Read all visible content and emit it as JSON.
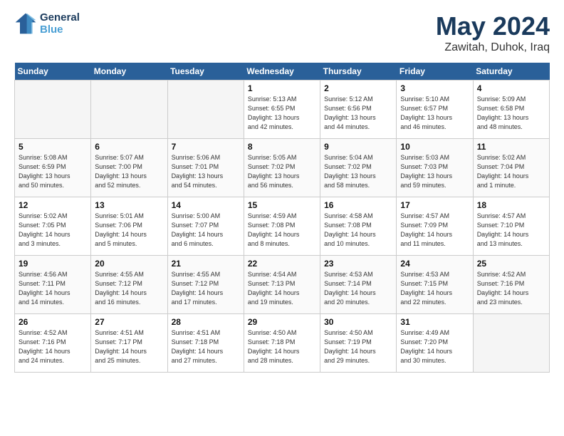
{
  "header": {
    "logo_line1": "General",
    "logo_line2": "Blue",
    "month": "May 2024",
    "location": "Zawitah, Duhok, Iraq"
  },
  "weekdays": [
    "Sunday",
    "Monday",
    "Tuesday",
    "Wednesday",
    "Thursday",
    "Friday",
    "Saturday"
  ],
  "weeks": [
    [
      {
        "day": "",
        "info": "",
        "empty": true
      },
      {
        "day": "",
        "info": "",
        "empty": true
      },
      {
        "day": "",
        "info": "",
        "empty": true
      },
      {
        "day": "1",
        "info": "Sunrise: 5:13 AM\nSunset: 6:55 PM\nDaylight: 13 hours\nand 42 minutes."
      },
      {
        "day": "2",
        "info": "Sunrise: 5:12 AM\nSunset: 6:56 PM\nDaylight: 13 hours\nand 44 minutes."
      },
      {
        "day": "3",
        "info": "Sunrise: 5:10 AM\nSunset: 6:57 PM\nDaylight: 13 hours\nand 46 minutes."
      },
      {
        "day": "4",
        "info": "Sunrise: 5:09 AM\nSunset: 6:58 PM\nDaylight: 13 hours\nand 48 minutes."
      }
    ],
    [
      {
        "day": "5",
        "info": "Sunrise: 5:08 AM\nSunset: 6:59 PM\nDaylight: 13 hours\nand 50 minutes."
      },
      {
        "day": "6",
        "info": "Sunrise: 5:07 AM\nSunset: 7:00 PM\nDaylight: 13 hours\nand 52 minutes."
      },
      {
        "day": "7",
        "info": "Sunrise: 5:06 AM\nSunset: 7:01 PM\nDaylight: 13 hours\nand 54 minutes."
      },
      {
        "day": "8",
        "info": "Sunrise: 5:05 AM\nSunset: 7:02 PM\nDaylight: 13 hours\nand 56 minutes."
      },
      {
        "day": "9",
        "info": "Sunrise: 5:04 AM\nSunset: 7:02 PM\nDaylight: 13 hours\nand 58 minutes."
      },
      {
        "day": "10",
        "info": "Sunrise: 5:03 AM\nSunset: 7:03 PM\nDaylight: 13 hours\nand 59 minutes."
      },
      {
        "day": "11",
        "info": "Sunrise: 5:02 AM\nSunset: 7:04 PM\nDaylight: 14 hours\nand 1 minute."
      }
    ],
    [
      {
        "day": "12",
        "info": "Sunrise: 5:02 AM\nSunset: 7:05 PM\nDaylight: 14 hours\nand 3 minutes."
      },
      {
        "day": "13",
        "info": "Sunrise: 5:01 AM\nSunset: 7:06 PM\nDaylight: 14 hours\nand 5 minutes."
      },
      {
        "day": "14",
        "info": "Sunrise: 5:00 AM\nSunset: 7:07 PM\nDaylight: 14 hours\nand 6 minutes."
      },
      {
        "day": "15",
        "info": "Sunrise: 4:59 AM\nSunset: 7:08 PM\nDaylight: 14 hours\nand 8 minutes."
      },
      {
        "day": "16",
        "info": "Sunrise: 4:58 AM\nSunset: 7:08 PM\nDaylight: 14 hours\nand 10 minutes."
      },
      {
        "day": "17",
        "info": "Sunrise: 4:57 AM\nSunset: 7:09 PM\nDaylight: 14 hours\nand 11 minutes."
      },
      {
        "day": "18",
        "info": "Sunrise: 4:57 AM\nSunset: 7:10 PM\nDaylight: 14 hours\nand 13 minutes."
      }
    ],
    [
      {
        "day": "19",
        "info": "Sunrise: 4:56 AM\nSunset: 7:11 PM\nDaylight: 14 hours\nand 14 minutes."
      },
      {
        "day": "20",
        "info": "Sunrise: 4:55 AM\nSunset: 7:12 PM\nDaylight: 14 hours\nand 16 minutes."
      },
      {
        "day": "21",
        "info": "Sunrise: 4:55 AM\nSunset: 7:12 PM\nDaylight: 14 hours\nand 17 minutes."
      },
      {
        "day": "22",
        "info": "Sunrise: 4:54 AM\nSunset: 7:13 PM\nDaylight: 14 hours\nand 19 minutes."
      },
      {
        "day": "23",
        "info": "Sunrise: 4:53 AM\nSunset: 7:14 PM\nDaylight: 14 hours\nand 20 minutes."
      },
      {
        "day": "24",
        "info": "Sunrise: 4:53 AM\nSunset: 7:15 PM\nDaylight: 14 hours\nand 22 minutes."
      },
      {
        "day": "25",
        "info": "Sunrise: 4:52 AM\nSunset: 7:16 PM\nDaylight: 14 hours\nand 23 minutes."
      }
    ],
    [
      {
        "day": "26",
        "info": "Sunrise: 4:52 AM\nSunset: 7:16 PM\nDaylight: 14 hours\nand 24 minutes."
      },
      {
        "day": "27",
        "info": "Sunrise: 4:51 AM\nSunset: 7:17 PM\nDaylight: 14 hours\nand 25 minutes."
      },
      {
        "day": "28",
        "info": "Sunrise: 4:51 AM\nSunset: 7:18 PM\nDaylight: 14 hours\nand 27 minutes."
      },
      {
        "day": "29",
        "info": "Sunrise: 4:50 AM\nSunset: 7:18 PM\nDaylight: 14 hours\nand 28 minutes."
      },
      {
        "day": "30",
        "info": "Sunrise: 4:50 AM\nSunset: 7:19 PM\nDaylight: 14 hours\nand 29 minutes."
      },
      {
        "day": "31",
        "info": "Sunrise: 4:49 AM\nSunset: 7:20 PM\nDaylight: 14 hours\nand 30 minutes."
      },
      {
        "day": "",
        "info": "",
        "empty": true
      }
    ]
  ]
}
